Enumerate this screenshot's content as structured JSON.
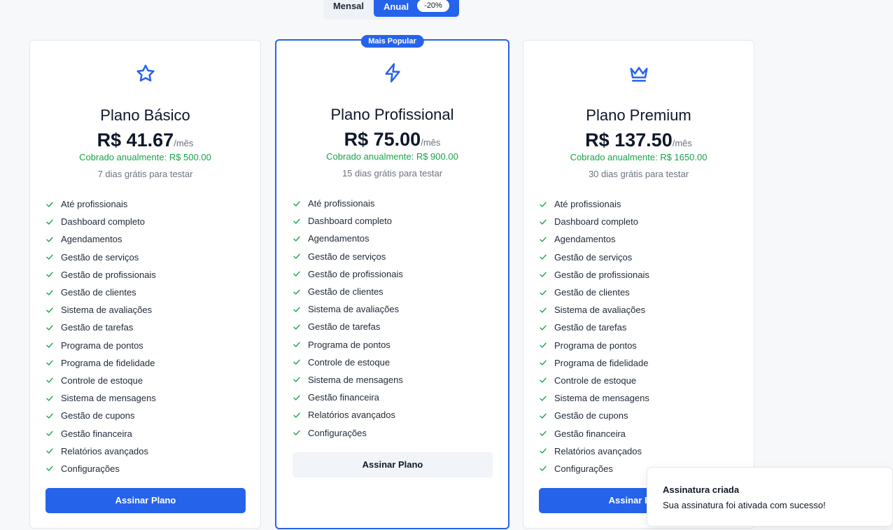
{
  "billing_toggle": {
    "monthly_label": "Mensal",
    "annual_label": "Anual",
    "discount_badge": "-20%",
    "selected": "annual"
  },
  "plans": [
    {
      "icon": "star-icon",
      "name": "Plano Básico",
      "price": "R$ 41.67",
      "period": "/mês",
      "billed_note": "Cobrado anualmente: R$ 500.00",
      "trial": "7 dias grátis para testar",
      "features": [
        "Até profissionais",
        "Dashboard completo",
        "Agendamentos",
        "Gestão de serviços",
        "Gestão de profissionais",
        "Gestão de clientes",
        "Sistema de avaliações",
        "Gestão de tarefas",
        "Programa de pontos",
        "Programa de fidelidade",
        "Controle de estoque",
        "Sistema de mensagens",
        "Gestão de cupons",
        "Gestão financeira",
        "Relatórios avançados",
        "Configurações"
      ],
      "button_label": "Assinar Plano"
    },
    {
      "icon": "lightning-icon",
      "badge": "Mais Popular",
      "name": "Plano Profissional",
      "price": "R$ 75.00",
      "period": "/mês",
      "billed_note": "Cobrado anualmente: R$ 900.00",
      "trial": "15 dias grátis para testar",
      "features": [
        "Até profissionais",
        "Dashboard completo",
        "Agendamentos",
        "Gestão de serviços",
        "Gestão de profissionais",
        "Gestão de clientes",
        "Sistema de avaliações",
        "Gestão de tarefas",
        "Programa de pontos",
        "Controle de estoque",
        "Sistema de mensagens",
        "Gestão financeira",
        "Relatórios avançados",
        "Configurações"
      ],
      "button_label": "Assinar Plano"
    },
    {
      "icon": "crown-icon",
      "name": "Plano Premium",
      "price": "R$ 137.50",
      "period": "/mês",
      "billed_note": "Cobrado anualmente: R$ 1650.00",
      "trial": "30 dias grátis para testar",
      "features": [
        "Até profissionais",
        "Dashboard completo",
        "Agendamentos",
        "Gestão de serviços",
        "Gestão de profissionais",
        "Gestão de clientes",
        "Sistema de avaliações",
        "Gestão de tarefas",
        "Programa de pontos",
        "Programa de fidelidade",
        "Controle de estoque",
        "Sistema de mensagens",
        "Gestão de cupons",
        "Gestão financeira",
        "Relatórios avançados",
        "Configurações"
      ],
      "button_label": "Assinar Plano"
    }
  ],
  "toast": {
    "title": "Assinatura criada",
    "description": "Sua assinatura foi ativada com sucesso!"
  },
  "colors": {
    "accent": "#2563eb",
    "success": "#16a34a",
    "muted_text": "#6b7280",
    "background": "#f7f8fa"
  }
}
